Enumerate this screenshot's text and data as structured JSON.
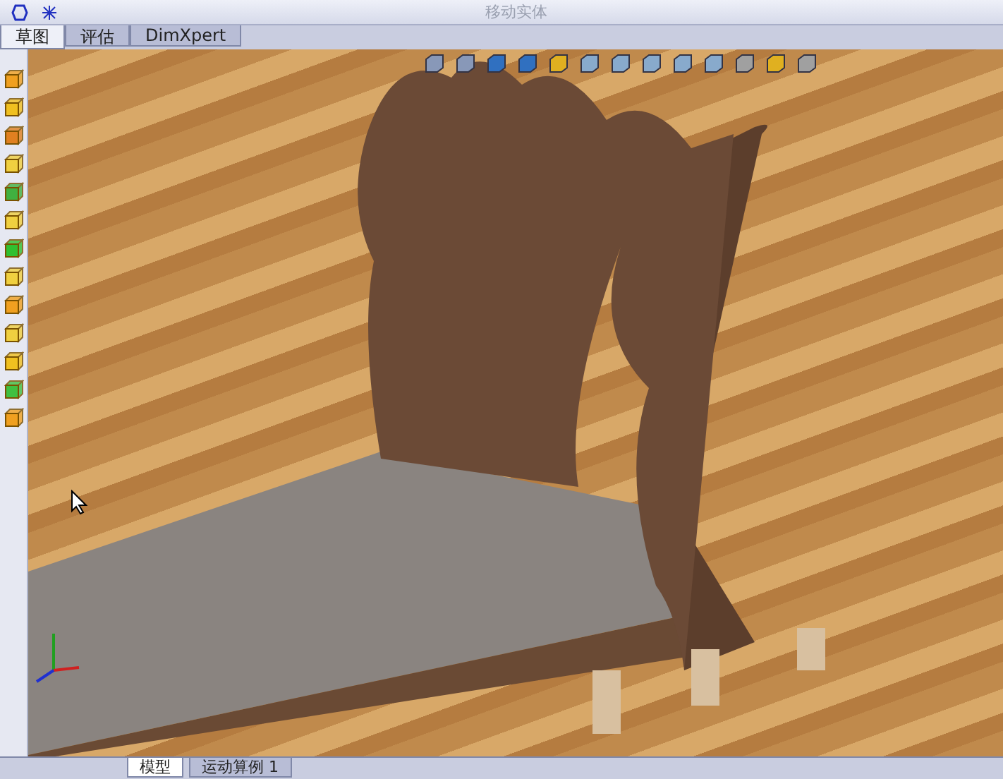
{
  "toolbar": {
    "command": {
      "label": "移动实体",
      "disabled": true
    }
  },
  "tabs": [
    {
      "label": "草图",
      "selected": true
    },
    {
      "label": "评估",
      "selected": false
    },
    {
      "label": "DimXpert",
      "selected": false
    }
  ],
  "bottom_tabs": [
    {
      "label": "模型",
      "selected": true
    },
    {
      "label": "运动算例 1",
      "selected": false
    }
  ]
}
